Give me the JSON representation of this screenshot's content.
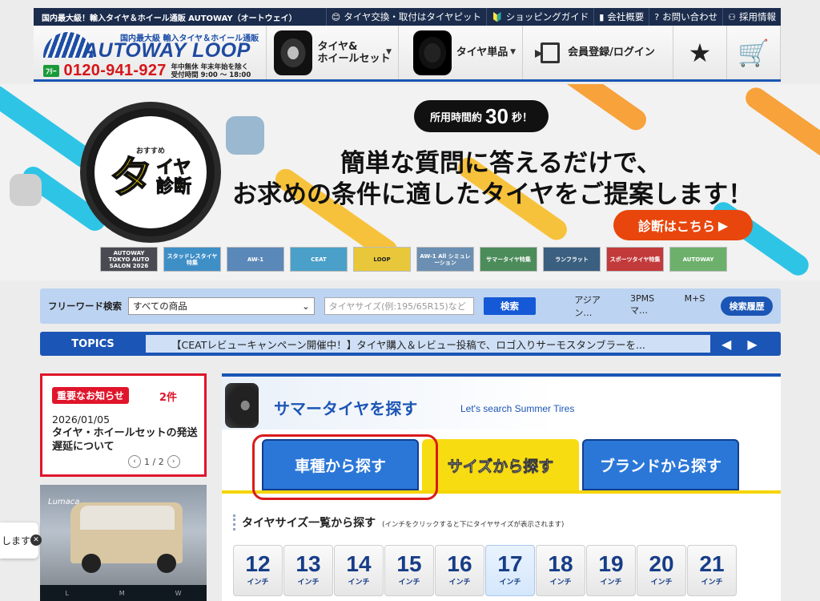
{
  "topbar": {
    "tagline": "国内最大級！輸入タイヤ＆ホイール通販 AUTOWAY（オートウェイ）",
    "links": [
      {
        "icon": "tire-face-icon",
        "label": "タイヤ交換・取付はタイヤピット"
      },
      {
        "icon": "beginner-leaf-icon",
        "label": "ショッピングガイド"
      },
      {
        "icon": "building-icon",
        "label": "会社概要"
      },
      {
        "icon": "question-icon",
        "label": "お問い合わせ"
      },
      {
        "icon": "people-icon",
        "label": "採用情報"
      }
    ]
  },
  "header": {
    "logo_sub": "国内最大級 輸入タイヤ＆ホイール通販",
    "logo_text": "AUTOWAY LOOP",
    "phone_badge": "ﾌﾘｰ",
    "phone": "0120-941-927",
    "hours_line1": "年中無休 年末年始を除く",
    "hours_line2": "受付時間 9:00 〜 18:00",
    "nav": {
      "set_label": "タイヤ&\nホイールセット",
      "single_label": "タイヤ単品",
      "login_label": "会員登録/ログイン"
    }
  },
  "banner": {
    "diag_small": "おすすめ",
    "diag_ta": "タ",
    "diag_ya": "イヤ",
    "diag_dan": "診断",
    "time_prefix": "所用時間約",
    "time_value": "30",
    "time_suffix": "秒！",
    "headline1": "簡単な質問に答えるだけで、",
    "headline2": "お求めの条件に適したタイヤをご提案します！",
    "cta": "診断はこちら",
    "thumbs": [
      "AUTOWAY TOKYO AUTO SALON 2026",
      "スタッドレスタイヤ特集",
      "AW-1",
      "CEAT",
      "LOOP",
      "AW-1 All シミュレーション",
      "サマータイヤ特集",
      "ランフラット",
      "スポーツタイヤ特集",
      "AUTOWAY"
    ]
  },
  "search": {
    "label": "フリーワード検索",
    "category": "すべての商品",
    "placeholder": "タイヤサイズ(例:195/65R15)など",
    "button": "検索",
    "keywords": [
      "アジアン…",
      "3PMSマ…",
      "M+S"
    ],
    "history": "検索履歴"
  },
  "topics": {
    "label": "TOPICS",
    "text": "【CEATレビューキャンペーン開催中！】タイヤ購入＆レビュー投稿で、ロゴ入りサーモスタンブラーを...",
    "prev": "◀",
    "next": "▶"
  },
  "notice": {
    "tag": "重要なお知らせ",
    "count": "2件",
    "date": "2026/01/05",
    "title": "タイヤ・ホイールセットの発送遅延について",
    "page": "1 / 2"
  },
  "photo": {
    "brand": "Lumaca",
    "tabs": [
      "L",
      "M",
      "W"
    ]
  },
  "popup": {
    "text": "します"
  },
  "summer": {
    "title": "サマータイヤを探す",
    "subtitle": "Let's search Summer Tires",
    "tabs": [
      "車種から探す",
      "サイズから探す",
      "ブランドから探す"
    ],
    "size_heading": "タイヤサイズ一覧から探す",
    "size_note": "(インチをクリックすると下にタイヤサイズが表示されます)",
    "inch_unit": "インチ",
    "inches": [
      "12",
      "13",
      "14",
      "15",
      "16",
      "17",
      "18",
      "19",
      "20",
      "21"
    ],
    "selected_inch": "17"
  },
  "colors": {
    "navy": "#1b2c4c",
    "brand_blue": "#1b55b5",
    "alert_red": "#e0152b",
    "cta_orange": "#e8460c",
    "yellow": "#f8dc12"
  }
}
